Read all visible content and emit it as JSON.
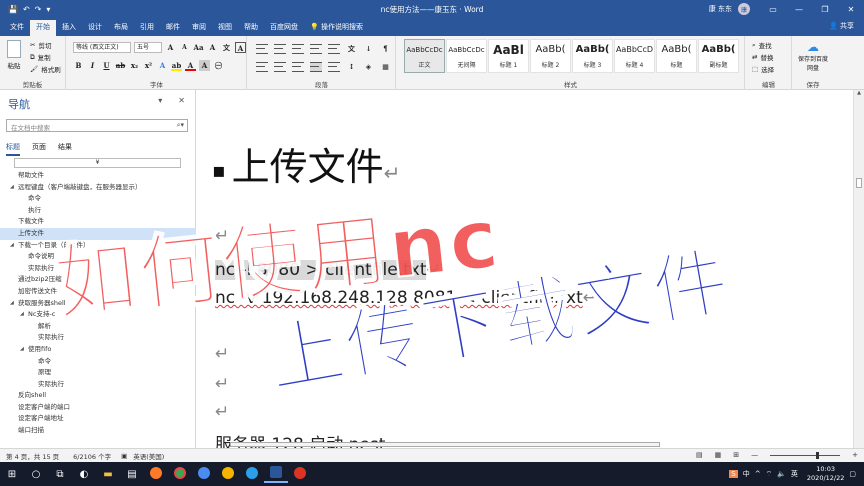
{
  "title_bar": {
    "document_title": "nc使用方法——康玉东 · Word",
    "user": "康 东东",
    "avatar_initial": "康",
    "minimize": "—",
    "restore": "❐",
    "close": "✕"
  },
  "tabs": [
    "文件",
    "开始",
    "插入",
    "设计",
    "布局",
    "引用",
    "邮件",
    "审阅",
    "视图",
    "帮助",
    "百度网盘",
    "操作说明搜索"
  ],
  "share_label": "共享",
  "ribbon": {
    "clipboard": {
      "paste": "粘贴",
      "cut": "剪切",
      "copy": "复制",
      "format_painter": "格式刷",
      "label": "剪贴板"
    },
    "font": {
      "family": "等线 (西文正文)",
      "size": "五号",
      "label": "字体"
    },
    "paragraph": {
      "label": "段落"
    },
    "styles": {
      "label": "样式",
      "items": [
        {
          "preview": "AaBbCcDc",
          "name": "正文"
        },
        {
          "preview": "AaBbCcDc",
          "name": "无间隔"
        },
        {
          "preview": "AaBl",
          "name": "标题 1"
        },
        {
          "preview": "AaBb(",
          "name": "标题 2"
        },
        {
          "preview": "AaBb(",
          "name": "标题 3"
        },
        {
          "preview": "AaBbCcD",
          "name": "标题 4"
        },
        {
          "preview": "AaBb(",
          "name": "标题"
        },
        {
          "preview": "AaBb(",
          "name": "副标题"
        }
      ]
    },
    "editing": {
      "find": "查找",
      "replace": "替换",
      "select": "选择",
      "label": "编辑"
    },
    "save": {
      "button": "保存到百度网盘",
      "label": "保存"
    }
  },
  "nav": {
    "heading": "导航",
    "search_placeholder": "在文档中搜索",
    "tabs": [
      "标题",
      "页面",
      "结果"
    ],
    "items": [
      {
        "text": "帮助文件",
        "level": 0,
        "caret": false,
        "selected": false
      },
      {
        "text": "远程键盘（客户端敲键盘，在服务器显示）",
        "level": 0,
        "caret": true,
        "selected": false
      },
      {
        "text": "命令",
        "level": 1,
        "caret": false,
        "selected": false
      },
      {
        "text": "执行",
        "level": 1,
        "caret": false,
        "selected": false
      },
      {
        "text": "下载文件",
        "level": 0,
        "caret": false,
        "selected": false
      },
      {
        "text": "上传文件",
        "level": 0,
        "caret": false,
        "selected": true
      },
      {
        "text": "下载一个目录（的文件）",
        "level": 0,
        "caret": true,
        "selected": false
      },
      {
        "text": "命令说明",
        "level": 1,
        "caret": false,
        "selected": false
      },
      {
        "text": "实际执行",
        "level": 1,
        "caret": false,
        "selected": false
      },
      {
        "text": "通过bzip2压缩",
        "level": 0,
        "caret": false,
        "selected": false
      },
      {
        "text": "加密传送文件",
        "level": 0,
        "caret": false,
        "selected": false
      },
      {
        "text": "获取服务器shell",
        "level": 0,
        "caret": true,
        "selected": false
      },
      {
        "text": "Nc支持-c",
        "level": 1,
        "caret": true,
        "selected": false
      },
      {
        "text": "解析",
        "level": 2,
        "caret": false,
        "selected": false
      },
      {
        "text": "实际执行",
        "level": 2,
        "caret": false,
        "selected": false
      },
      {
        "text": "使用fifo",
        "level": 1,
        "caret": true,
        "selected": false
      },
      {
        "text": "命令",
        "level": 2,
        "caret": false,
        "selected": false
      },
      {
        "text": "原理",
        "level": 2,
        "caret": false,
        "selected": false
      },
      {
        "text": "实际执行",
        "level": 2,
        "caret": false,
        "selected": false
      },
      {
        "text": "反向shell",
        "level": 0,
        "caret": false,
        "selected": false
      },
      {
        "text": "设定客户端的端口",
        "level": 0,
        "caret": false,
        "selected": false
      },
      {
        "text": "设定客户端地址",
        "level": 0,
        "caret": false,
        "selected": false
      },
      {
        "text": "端口扫描",
        "level": 0,
        "caret": false,
        "selected": false
      }
    ]
  },
  "document": {
    "heading": "上传文件",
    "pilcrow": "↵",
    "line1": "nc -l 8080 > clientfile.txt",
    "line2": "nc -v 192.168.248.128 8081 < clientfile.txt",
    "line_bottom": "服务器 128 启动 nest"
  },
  "overlay": {
    "red_text": "如何使用nc",
    "blue_text": "上传下载文件"
  },
  "status_bar": {
    "page": "第 4 页，共 15 页",
    "words": "6/2106 个字",
    "language": "英语(美国)",
    "zoom": "+"
  },
  "taskbar": {
    "time": "10:03",
    "date": "2020/12/22",
    "ime": "中",
    "ime2": "英"
  }
}
